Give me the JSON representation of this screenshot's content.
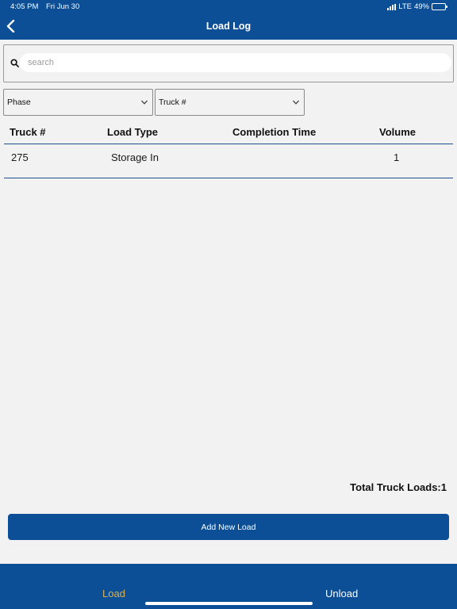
{
  "status_bar": {
    "time": "4:05 PM",
    "date": "Fri Jun 30",
    "network": "LTE",
    "battery": "49%",
    "battery_level": 0.49
  },
  "nav": {
    "title": "Load Log",
    "back_icon": "chevron-left-icon"
  },
  "search": {
    "placeholder": "search",
    "value": "",
    "icon": "search-icon"
  },
  "filters": {
    "phase_label": "Phase",
    "truck_label": "Truck #"
  },
  "table": {
    "headers": {
      "truck": "Truck #",
      "load_type": "Load Type",
      "completion_time": "Completion Time",
      "volume": "Volume"
    },
    "rows": [
      {
        "truck": "275",
        "load_type": "Storage In",
        "completion_time": "",
        "volume": "1"
      }
    ]
  },
  "summary": {
    "total_loads": "Total Truck Loads:1"
  },
  "actions": {
    "add_new_load": "Add New Load"
  },
  "tabs": {
    "load": "Load",
    "unload": "Unload"
  },
  "colors": {
    "primary": "#0c4f97",
    "active_tab": "#d6b25a",
    "background": "#f2f2f2"
  }
}
